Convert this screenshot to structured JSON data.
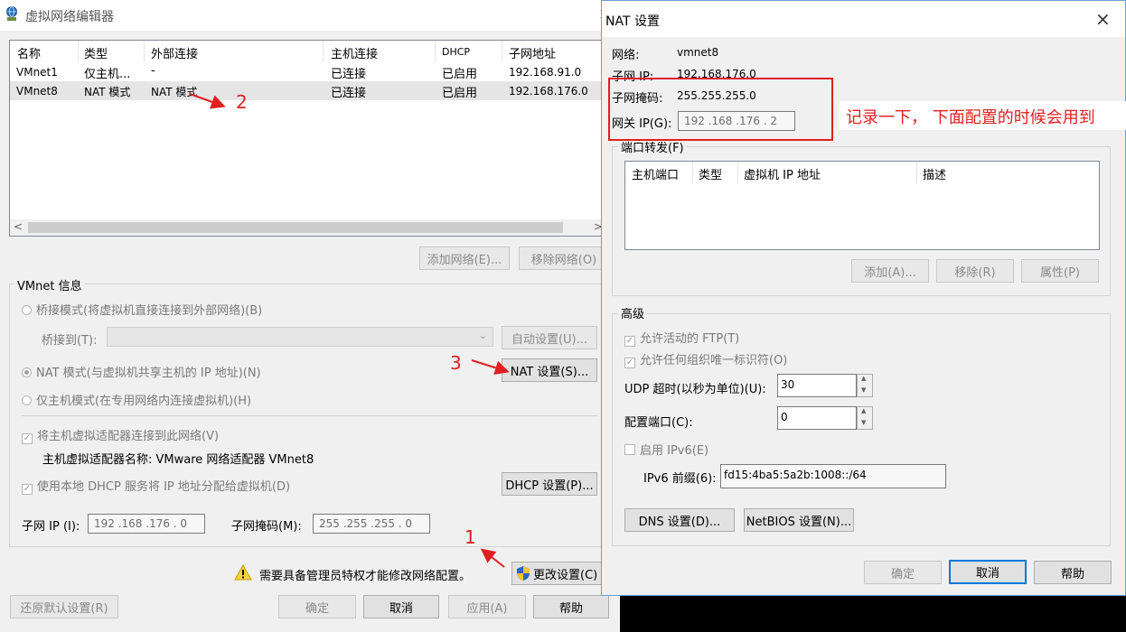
{
  "vne": {
    "title": "虚拟网络编辑器",
    "close_glyph": "×",
    "columns": [
      "名称",
      "类型",
      "外部连接",
      "主机连接",
      "DHCP",
      "子网地址"
    ],
    "rows": [
      [
        "VMnet1",
        "仅主机...",
        "-",
        "已连接",
        "已启用",
        "192.168.91.0"
      ],
      [
        "VMnet8",
        "NAT 模式",
        "NAT 模式",
        "已连接",
        "已启用",
        "192.168.176.0"
      ]
    ],
    "add_network": "添加网络(E)...",
    "remove_network": "移除网络(O)",
    "info_title": "VMnet 信息",
    "bridge_mode": "桥接模式(将虚拟机直接连接到外部网络)(B)",
    "bridge_to": "桥接到(T):",
    "auto_settings": "自动设置(U)...",
    "nat_mode": "NAT 模式(与虚拟机共享主机的 IP 地址)(N)",
    "nat_settings": "NAT 设置(S)...",
    "host_only": "仅主机模式(在专用网络内连接虚拟机)(H)",
    "connect_adapter": "将主机虚拟适配器连接到此网络(V)",
    "adapter_name": "主机虚拟适配器名称: VMware 网络适配器 VMnet8",
    "use_dhcp": "使用本地 DHCP 服务将 IP 地址分配给虚拟机(D)",
    "dhcp_settings": "DHCP 设置(P)...",
    "subnet_ip_label": "子网 IP (I):",
    "subnet_ip": "192 .168 .176 .  0",
    "subnet_mask_label": "子网掩码(M):",
    "subnet_mask": "255 .255 .255 .  0",
    "admin_warning": "需要具备管理员特权才能修改网络配置。",
    "change_settings": "更改设置(C)",
    "restore_defaults": "还原默认设置(R)",
    "ok": "确定",
    "cancel": "取消",
    "apply": "应用(A)",
    "help": "帮助"
  },
  "nat": {
    "title": "NAT 设置",
    "close_glyph": "×",
    "network_label": "网络:",
    "network_value": "vmnet8",
    "subnet_ip_label": "子网 IP:",
    "subnet_ip_value": "192.168.176.0",
    "subnet_mask_label": "子网掩码:",
    "subnet_mask_value": "255.255.255.0",
    "gateway_label": "网关 IP(G):",
    "gateway_value": "192 .168 .176 .  2",
    "port_forward_title": "端口转发(F)",
    "pf_columns": [
      "主机端口",
      "类型",
      "虚拟机 IP 地址",
      "描述"
    ],
    "add": "添加(A)...",
    "remove": "移除(R)",
    "properties": "属性(P)",
    "advanced_title": "高级",
    "allow_ftp": "允许活动的 FTP(T)",
    "allow_org_id": "允许任何组织唯一标识符(O)",
    "udp_timeout_label": "UDP 超时(以秒为单位)(U):",
    "udp_timeout": "30",
    "config_port_label": "配置端口(C):",
    "config_port": "0",
    "enable_ipv6": "启用 IPv6(E)",
    "ipv6_prefix_label": "IPv6 前缀(6):",
    "ipv6_prefix": "fd15:4ba5:5a2b:1008::/64",
    "dns_settings": "DNS 设置(D)...",
    "netbios_settings": "NetBIOS 设置(N)...",
    "ok": "确定",
    "cancel": "取消",
    "help": "帮助"
  },
  "annotations": {
    "note": "记录一下， 下面配置的时候会用到",
    "n1": "1",
    "n2": "2",
    "n3": "3",
    "color": "#e02020"
  }
}
